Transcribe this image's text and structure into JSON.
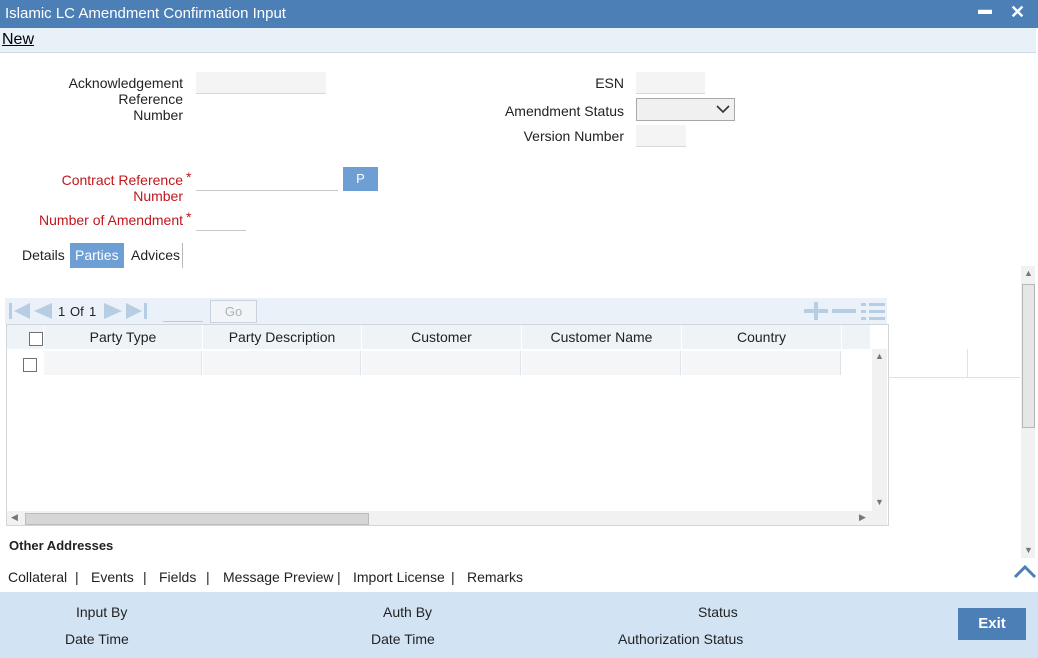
{
  "window": {
    "title": "Islamic LC Amendment Confirmation Input",
    "minimize": "▬",
    "close": "✕"
  },
  "menu": {
    "new_label": "New"
  },
  "form": {
    "ack_ref_label_line1": "Acknowledgement Reference",
    "ack_ref_label_line2": "Number",
    "ack_ref_value": "",
    "esn_label": "ESN",
    "esn_value": "",
    "amendment_status_label": "Amendment Status",
    "amendment_status_value": "",
    "version_number_label": "Version Number",
    "version_number_value": "",
    "contract_ref_label": "Contract Reference Number",
    "contract_ref_value": "",
    "p_button_label": "P",
    "num_amendment_label": "Number of Amendment",
    "num_amendment_value": "",
    "required_marker": "*"
  },
  "tabs": [
    {
      "label": "Details",
      "active": false
    },
    {
      "label": "Parties",
      "active": true
    },
    {
      "label": "Advices",
      "active": false
    }
  ],
  "grid": {
    "pager_current": "1",
    "pager_of": "Of",
    "pager_total": "1",
    "go_label": "Go",
    "columns": [
      "Party Type",
      "Party Description",
      "Customer",
      "Customer Name",
      "Country"
    ],
    "rows": [
      [
        "",
        "",
        "",
        "",
        ""
      ]
    ]
  },
  "other_addresses_label": "Other Addresses",
  "bottom_tabs": [
    "Collateral",
    "Events",
    "Fields",
    "Message Preview",
    "Import License",
    "Remarks"
  ],
  "bottom_separator": "|",
  "footer": {
    "input_by_label": "Input By",
    "date_time_label_1": "Date Time",
    "auth_by_label": "Auth By",
    "date_time_label_2": "Date Time",
    "status_label": "Status",
    "authorization_status_label": "Authorization Status",
    "exit_label": "Exit"
  },
  "colors": {
    "titlebar": "#4b7fb5",
    "accent": "#6d9ed4",
    "required": "#c0171c",
    "footer": "#d2e4f4"
  }
}
